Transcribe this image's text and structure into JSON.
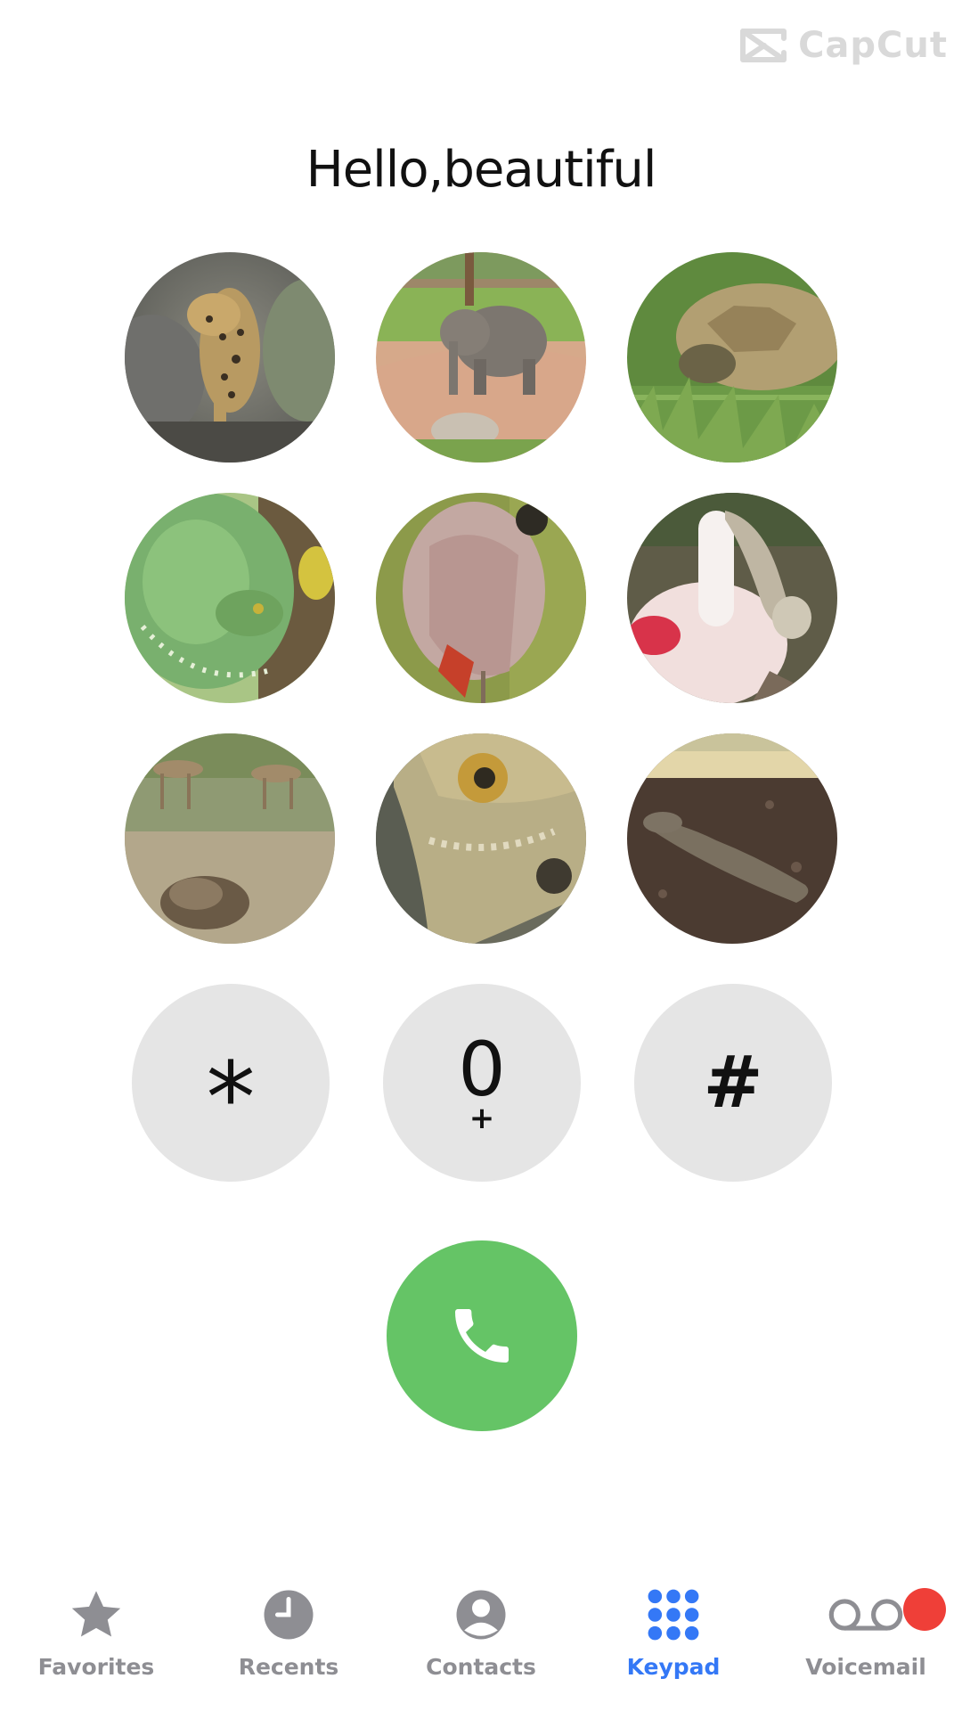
{
  "watermark": {
    "text": "CapCut",
    "icon": "capcut-logo-icon"
  },
  "greeting": "Hello,beautiful",
  "photos": [
    {
      "subject": "leopard",
      "icon": "leopard-photo"
    },
    {
      "subject": "elephant",
      "icon": "elephant-photo"
    },
    {
      "subject": "tortoise",
      "icon": "tortoise-photo"
    },
    {
      "subject": "green tree python",
      "icon": "snake-photo"
    },
    {
      "subject": "flamingo",
      "icon": "flamingo-photo"
    },
    {
      "subject": "roseate spoonbill",
      "icon": "spoonbill-photo"
    },
    {
      "subject": "gazelles",
      "icon": "gazelle-photo"
    },
    {
      "subject": "iguana",
      "icon": "iguana-photo"
    },
    {
      "subject": "komodo dragon",
      "icon": "komodo-photo"
    }
  ],
  "keys": [
    {
      "main": "*",
      "sub": ""
    },
    {
      "main": "0",
      "sub": "+"
    },
    {
      "main": "#",
      "sub": ""
    }
  ],
  "call": {
    "icon": "phone-icon",
    "color": "#65c466"
  },
  "tabs": [
    {
      "label": "Favorites",
      "icon": "star-icon",
      "active": false
    },
    {
      "label": "Recents",
      "icon": "clock-icon",
      "active": false
    },
    {
      "label": "Contacts",
      "icon": "person-icon",
      "active": false
    },
    {
      "label": "Keypad",
      "icon": "keypad-grid-icon",
      "active": true
    },
    {
      "label": "Voicemail",
      "icon": "voicemail-icon",
      "active": false,
      "badge": true
    }
  ],
  "colors": {
    "accent": "#3478f6",
    "inactive": "#8e8e93",
    "key_background": "#e5e5e5",
    "badge": "#ef3f38"
  }
}
